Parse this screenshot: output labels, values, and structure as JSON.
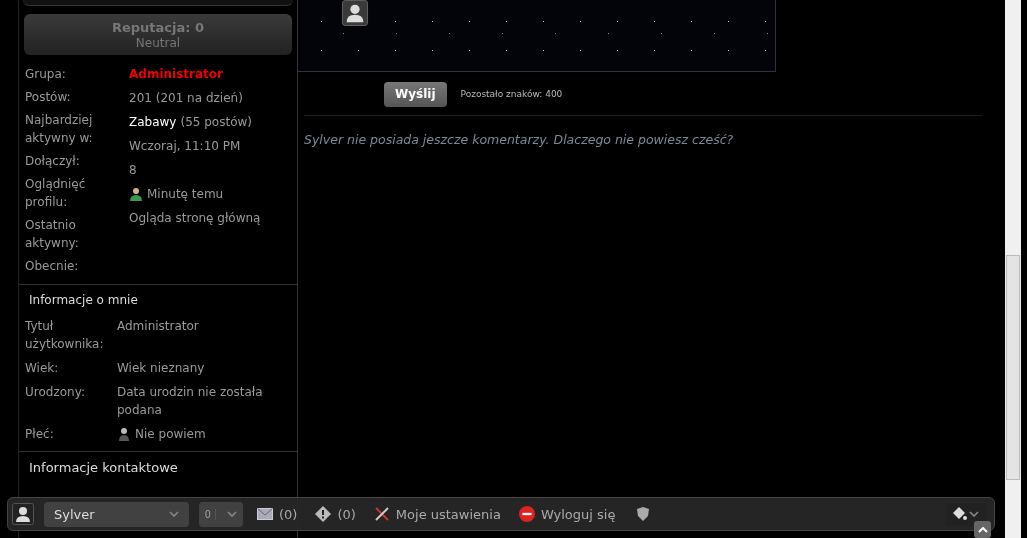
{
  "reputation": {
    "title": "Reputacja: 0",
    "label": "Neutral"
  },
  "profile": {
    "labels": [
      "Grupa:",
      "Postów:",
      "Najbardziej aktywny w:",
      "Dołączył:",
      "Oglądnięć profilu:",
      "Ostatnio aktywny:",
      "Obecnie:"
    ],
    "values": [
      {
        "kind": "group",
        "text": "Administrator"
      },
      {
        "kind": "text",
        "text": "201 (201 na dzień)"
      },
      {
        "kind": "forum",
        "link": "Zabawy",
        "text": "(55 postów)"
      },
      {
        "kind": "text",
        "text": "Wczoraj, 11:10 PM"
      },
      {
        "kind": "text",
        "text": "8"
      },
      {
        "kind": "online",
        "text": "Minutę temu"
      },
      {
        "kind": "text",
        "text": "Ogląda stronę główną"
      }
    ]
  },
  "about": {
    "title": "Informacje o mnie",
    "rows": [
      {
        "kind": "text",
        "label": "Tytuł użytkownika:",
        "value": "Administrator"
      },
      {
        "kind": "text",
        "label": "Wiek:",
        "value": "Wiek nieznany"
      },
      {
        "kind": "text",
        "label": "Urodzony:",
        "value": "Data urodzin nie została podana"
      },
      {
        "kind": "person",
        "label": "Płeć:",
        "value": "Nie powiem"
      }
    ]
  },
  "contact": {
    "title": "Informacje kontaktowe"
  },
  "comment_form": {
    "submit": "Wyślij",
    "remaining": "Pozostało znaków: 400"
  },
  "comments_empty": "Sylver nie posiada jeszcze komentarzy. Dlaczego nie powiesz cześć?",
  "toolbar": {
    "user": "Sylver",
    "count": "0",
    "messages": "(0)",
    "reports": "(0)",
    "settings": "Moje ustawienia",
    "logout": "Wyloguj się"
  }
}
